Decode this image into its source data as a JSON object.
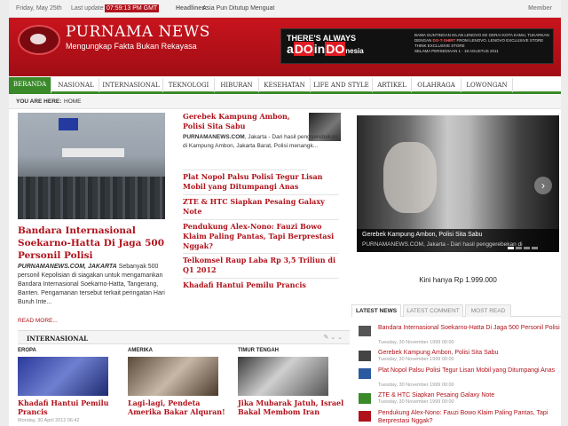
{
  "topbar": {
    "date": "Friday, May 25th",
    "update_label": "Last update",
    "update_time": "07:59:13 PM GMT",
    "headlines_label": "Headlines:",
    "headline": "Asia Pun Ditutup Menguat",
    "member": "Member"
  },
  "header": {
    "title": "PURNAMA NEWS",
    "tagline": "Mengungkap Fakta Bukan Rekayasa",
    "ad_line1": "THERE'S ALWAYS",
    "ad_line2a": "a",
    "ad_line2b": "DO",
    "ad_line2c": "in",
    "ad_line2d": "DO",
    "ad_line2e": "nesia",
    "ad_info": "BAWA GUNTINGAN IKLAN LENOVO KE GERAI KOTA KAMU, TUKARKAN DENGAN",
    "ad_info_hl": "DO-T-SHIRT",
    "ad_info2": "FROM LENOVO. LENOVO EXCLUSIVE STORE THINK EXCLUSIVE STORE",
    "ad_info3": "SELAMA PERSEDIAAN 1 - 18 AGUSTUS 2011"
  },
  "nav": {
    "items": [
      "BERANDA",
      "NASIONAL",
      "INTERNASIONAL",
      "TEKNOLOGI",
      "HIBURAN",
      "KESEHATAN",
      "LIFE AND STYLE",
      "ARTIKEL",
      "OLAHRAGA",
      "LOWONGAN"
    ]
  },
  "breadcrumb": {
    "label": "YOU ARE HERE:",
    "current": "HOME"
  },
  "feature": {
    "title": "Bandara Internasional Soekarno-Hatta Di Jaga 500 Personil Polisi",
    "source": "PURNAMANEWS.COM, JAKARTA",
    "text": " Sebanyak 500 personil Kepolisian di siagakan untuk mengamankan Bandara Internasional Soekarno-Hatta, Tangerang, Banten. Pengamanan tersebut terkait peringatan Hari Buruh Inte...",
    "read_more": "READ MORE..."
  },
  "middle": [
    {
      "title": "Gerebek Kampung Ambon, Polisi Sita Sabu",
      "source": "PURNAMANEWS.COM",
      "text": ", Jakarta - Dari hasil penggerebekan di Kampung Ambon, Jakarta Barat, Polisi menangk..."
    },
    {
      "title": "Plat Nopol Palsu Polisi Tegur Lisan Mobil yang Ditumpangi Anas"
    },
    {
      "title": "ZTE & HTC Siapkan Pesaing Galaxy Note"
    },
    {
      "title": "Pendukung Alex-Nono: Fauzi Bowo Klaim Paling Pantas, Tapi Berprestasi Nggak?"
    },
    {
      "title": "Telkomsel Raup Laba Rp 3,5 Triliun di Q1 2012"
    },
    {
      "title": "Khadafi Hantui Pemilu Prancis"
    }
  ],
  "slider": {
    "caption": "Gerebek Kampung Ambon, Polisi Sita Sabu",
    "sub": "PURNAMANEWS.COM, Jakarta - Dari hasil penggerebekan di",
    "next": "›"
  },
  "price_text": "Kini hanya Rp 1.999.000",
  "tabs": [
    "LATEST NEWS",
    "LATEST COMMENT",
    "MOST READ"
  ],
  "latest": [
    {
      "title": "Bandara Internasional Soekarno-Hatta Di Jaga 500 Personil Polisi",
      "date": "Tuesday, 30 November 1999 00:00",
      "color": "#555555"
    },
    {
      "title": "Gerebek Kampung Ambon, Polisi Sita Sabu",
      "date": "Tuesday, 30 November 1999 00:00",
      "color": "#444444"
    },
    {
      "title": "Plat Nopol Palsu Polisi Tegur Lisan Mobil yang Ditumpangi Anas",
      "date": "Tuesday, 30 November 1999 00:00",
      "color": "#2a5aa0"
    },
    {
      "title": "ZTE & HTC Siapkan Pesaing Galaxy Note",
      "date": "Tuesday, 30 November 1999 00:00",
      "color": "#3a8a2a"
    },
    {
      "title": "Pendukung Alex-Nono: Fauzi Bowo Klaim Paling Pantas, Tapi Berprestasi Nggak?",
      "date": "",
      "color": "#b0121b"
    }
  ],
  "internasional": {
    "heading": "INTERNASIONAL",
    "tools": "✎ ⌄ ⌄",
    "columns": [
      {
        "label": "EROPA",
        "title": "Khadafi Hantui Pemilu Prancis",
        "date": "Monday, 30 April 2012 06:42",
        "color": "#2a3a9a"
      },
      {
        "label": "AMERIKA",
        "title": "Lagi-lagi, Pendeta Amerika Bakar Alquran!",
        "date": "",
        "color": "#7a6a5a"
      },
      {
        "label": "TIMUR TENGAH",
        "title": "Jika Mubarak Jatuh, Israel Bakal Membom Iran",
        "date": "",
        "color": "#5a5a5a"
      }
    ]
  }
}
